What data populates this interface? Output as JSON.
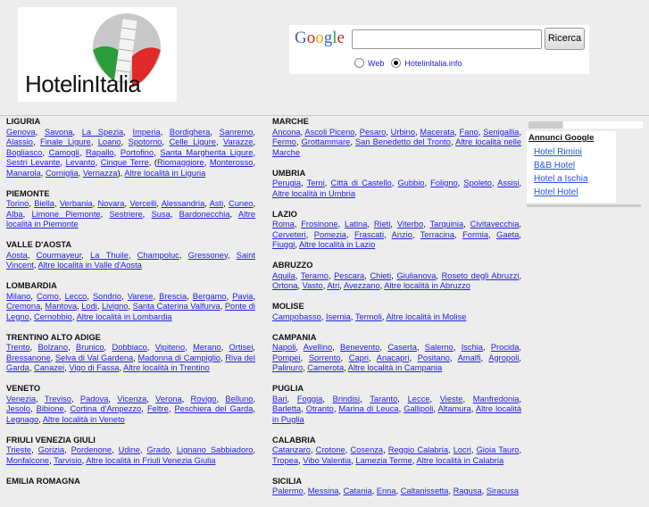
{
  "logo": {
    "text": "HotelinItalia"
  },
  "search": {
    "google_label": "Google",
    "button": "Ricerca",
    "input_value": "",
    "options": [
      {
        "label": "Web",
        "selected": false
      },
      {
        "label": "HotelinItalia.info",
        "selected": true
      }
    ]
  },
  "ads": {
    "title": "Annunci Google",
    "links": [
      "Hotel Rimini",
      "B&B Hotel",
      "Hotel a Ischia",
      "Hotel Hotel"
    ]
  },
  "columns": [
    [
      {
        "name": "LIGURIA",
        "links": [
          {
            "t": "Genova"
          },
          {
            "t": "Savona"
          },
          {
            "t": "La Spezia"
          },
          {
            "t": "Imperia"
          },
          {
            "t": "Bordighera"
          },
          {
            "t": "Sanremo"
          },
          {
            "t": "Alassio"
          },
          {
            "t": "Finale Ligure"
          },
          {
            "t": "Loano"
          },
          {
            "t": "Spotorno"
          },
          {
            "t": "Celle Ligure"
          },
          {
            "t": "Varazze"
          },
          {
            "t": "Bogliasco"
          },
          {
            "t": "Camogli"
          },
          {
            "t": "Rapallo"
          },
          {
            "t": "Portofino"
          },
          {
            "t": "Santa Margherita Ligure"
          },
          {
            "t": "Sestri Levante"
          },
          {
            "t": "Levanto"
          },
          {
            "t": "Cinque Terre"
          },
          {
            "t": "Riomaggiore",
            "pre": "("
          },
          {
            "t": "Monterosso"
          },
          {
            "t": "Manarola"
          },
          {
            "t": "Corniglia"
          },
          {
            "t": "Vernazza",
            "post": ")"
          },
          {
            "t": "Altre località in Liguria"
          }
        ]
      },
      {
        "name": "PIEMONTE",
        "links": [
          {
            "t": "Torino"
          },
          {
            "t": "Biella"
          },
          {
            "t": "Verbania"
          },
          {
            "t": "Novara"
          },
          {
            "t": "Vercelli"
          },
          {
            "t": "Alessandria"
          },
          {
            "t": "Asti"
          },
          {
            "t": "Cuneo"
          },
          {
            "t": "Alba"
          },
          {
            "t": "Limone Piemonte"
          },
          {
            "t": "Sestriere"
          },
          {
            "t": "Susa"
          },
          {
            "t": "Bardonecchia"
          },
          {
            "t": "Altre località in Piemonte"
          }
        ]
      },
      {
        "name": "VALLE D'AOSTA",
        "links": [
          {
            "t": "Aosta"
          },
          {
            "t": "Courmayeur"
          },
          {
            "t": "La Thuile"
          },
          {
            "t": "Champoluc"
          },
          {
            "t": "Gressoney"
          },
          {
            "t": "Saint Vincent"
          },
          {
            "t": "Altre località in Valle d'Aosta"
          }
        ]
      },
      {
        "name": "LOMBARDIA",
        "links": [
          {
            "t": "Milano"
          },
          {
            "t": "Como"
          },
          {
            "t": "Lecco"
          },
          {
            "t": "Sondrio"
          },
          {
            "t": "Varese"
          },
          {
            "t": "Brescia"
          },
          {
            "t": "Bergamo"
          },
          {
            "t": "Pavia"
          },
          {
            "t": "Cremona"
          },
          {
            "t": "Mantova"
          },
          {
            "t": "Lodi"
          },
          {
            "t": "Livigno"
          },
          {
            "t": "Santa Caterina Valfurva"
          },
          {
            "t": "Ponte di Legno"
          },
          {
            "t": "Cernobbio"
          },
          {
            "t": "Altre località in Lombardia"
          }
        ]
      },
      {
        "name": "TRENTINO ALTO ADIGE",
        "links": [
          {
            "t": "Trento"
          },
          {
            "t": "Bolzano"
          },
          {
            "t": "Brunico"
          },
          {
            "t": "Dobbiaco"
          },
          {
            "t": "Vipiteno"
          },
          {
            "t": "Merano"
          },
          {
            "t": "Ortisei"
          },
          {
            "t": "Bressanone"
          },
          {
            "t": "Selva di Val Gardena"
          },
          {
            "t": "Madonna di Campiglio"
          },
          {
            "t": "Riva del Garda"
          },
          {
            "t": "Canazei"
          },
          {
            "t": "Vigo di Fassa"
          },
          {
            "t": "Altre località in Trentino"
          }
        ]
      },
      {
        "name": "VENETO",
        "links": [
          {
            "t": "Venezia"
          },
          {
            "t": "Treviso"
          },
          {
            "t": "Padova"
          },
          {
            "t": "Vicenza"
          },
          {
            "t": "Verona"
          },
          {
            "t": "Rovigo"
          },
          {
            "t": "Belluno"
          },
          {
            "t": "Jesolo"
          },
          {
            "t": "Bibione"
          },
          {
            "t": "Cortina d'Ampezzo"
          },
          {
            "t": "Feltre"
          },
          {
            "t": "Peschiera del Garda"
          },
          {
            "t": "Legnago"
          },
          {
            "t": "Altre località in Veneto"
          }
        ]
      },
      {
        "name": "FRIULI VENEZIA GIULI",
        "links": [
          {
            "t": "Trieste"
          },
          {
            "t": "Gorizia"
          },
          {
            "t": "Pordenone"
          },
          {
            "t": "Udine"
          },
          {
            "t": "Grado"
          },
          {
            "t": "Lignano Sabbiadoro"
          },
          {
            "t": "Monfalcone"
          },
          {
            "t": "Tarvisio"
          },
          {
            "t": "Altre località in Friuli Venezia Giulia"
          }
        ]
      },
      {
        "name": "EMILIA ROMAGNA",
        "links": []
      }
    ],
    [
      {
        "name": "MARCHE",
        "links": [
          {
            "t": "Ancona"
          },
          {
            "t": "Ascoli Piceno"
          },
          {
            "t": "Pesaro"
          },
          {
            "t": "Urbino"
          },
          {
            "t": "Macerata"
          },
          {
            "t": "Fano"
          },
          {
            "t": "Senigallia"
          },
          {
            "t": "Fermo"
          },
          {
            "t": "Grottammare"
          },
          {
            "t": "San Benedetto del Tronto"
          },
          {
            "t": "Altre località nelle Marche"
          }
        ]
      },
      {
        "name": "UMBRIA",
        "links": [
          {
            "t": "Perugia"
          },
          {
            "t": "Terni"
          },
          {
            "t": "Città di Castello"
          },
          {
            "t": "Gubbio"
          },
          {
            "t": "Foligno"
          },
          {
            "t": "Spoleto"
          },
          {
            "t": "Assisi"
          },
          {
            "t": "Altre località in Umbria"
          }
        ]
      },
      {
        "name": "LAZIO",
        "links": [
          {
            "t": "Roma"
          },
          {
            "t": "Frosinone"
          },
          {
            "t": "Latina"
          },
          {
            "t": "Rieti"
          },
          {
            "t": "Viterbo"
          },
          {
            "t": "Tarquinia"
          },
          {
            "t": "Civitavecchia"
          },
          {
            "t": "Cerveteri"
          },
          {
            "t": "Pomezia"
          },
          {
            "t": "Frascati"
          },
          {
            "t": "Anzio"
          },
          {
            "t": "Terracina"
          },
          {
            "t": "Formia"
          },
          {
            "t": "Gaeta"
          },
          {
            "t": "Fiuggi"
          },
          {
            "t": "Altre località in Lazio"
          }
        ]
      },
      {
        "name": "ABRUZZO",
        "links": [
          {
            "t": "Aquila"
          },
          {
            "t": "Teramo"
          },
          {
            "t": "Pescara"
          },
          {
            "t": "Chieti"
          },
          {
            "t": "Giulianova"
          },
          {
            "t": "Roseto degli Abruzzi"
          },
          {
            "t": "Ortona"
          },
          {
            "t": "Vasto"
          },
          {
            "t": "Atri"
          },
          {
            "t": "Avezzano"
          },
          {
            "t": "Altre località in Abruzzo"
          }
        ]
      },
      {
        "name": "MOLISE",
        "links": [
          {
            "t": "Campobasso"
          },
          {
            "t": "Isernia"
          },
          {
            "t": "Termoli"
          },
          {
            "t": "Altre località in Molise"
          }
        ]
      },
      {
        "name": "CAMPANIA",
        "links": [
          {
            "t": "Napoli"
          },
          {
            "t": "Avellino"
          },
          {
            "t": "Benevento"
          },
          {
            "t": "Caserta"
          },
          {
            "t": "Salerno"
          },
          {
            "t": "Ischia"
          },
          {
            "t": "Procida"
          },
          {
            "t": "Pompei"
          },
          {
            "t": "Sorrento"
          },
          {
            "t": "Capri"
          },
          {
            "t": "Anacapri"
          },
          {
            "t": "Positano"
          },
          {
            "t": "Amalfi"
          },
          {
            "t": "Agropoli"
          },
          {
            "t": "Palinuro"
          },
          {
            "t": "Camerota"
          },
          {
            "t": "Altre località in Campania"
          }
        ]
      },
      {
        "name": "PUGLIA",
        "links": [
          {
            "t": "Bari"
          },
          {
            "t": "Foggia"
          },
          {
            "t": "Brindisi"
          },
          {
            "t": "Taranto"
          },
          {
            "t": "Lecce"
          },
          {
            "t": "Vieste"
          },
          {
            "t": "Manfredonia"
          },
          {
            "t": "Barletta"
          },
          {
            "t": "Otranto"
          },
          {
            "t": "Marina di Leuca"
          },
          {
            "t": "Gallipoli"
          },
          {
            "t": "Altamura"
          },
          {
            "t": "Altre località in Puglia"
          }
        ]
      },
      {
        "name": "CALABRIA",
        "links": [
          {
            "t": "Catanzaro"
          },
          {
            "t": "Crotone"
          },
          {
            "t": "Cosenza"
          },
          {
            "t": "Reggio Calabria"
          },
          {
            "t": "Locri"
          },
          {
            "t": "Gioia Tauro"
          },
          {
            "t": "Tropea"
          },
          {
            "t": "Vibo Valentia"
          },
          {
            "t": "Lamezia Terme"
          },
          {
            "t": "Altre località in Calabria"
          }
        ]
      },
      {
        "name": "SICILIA",
        "links": [
          {
            "t": "Palermo"
          },
          {
            "t": "Messina"
          },
          {
            "t": "Catania"
          },
          {
            "t": "Enna"
          },
          {
            "t": "Caltanissetta"
          },
          {
            "t": "Ragusa"
          },
          {
            "t": "Siracusa"
          }
        ]
      }
    ]
  ]
}
